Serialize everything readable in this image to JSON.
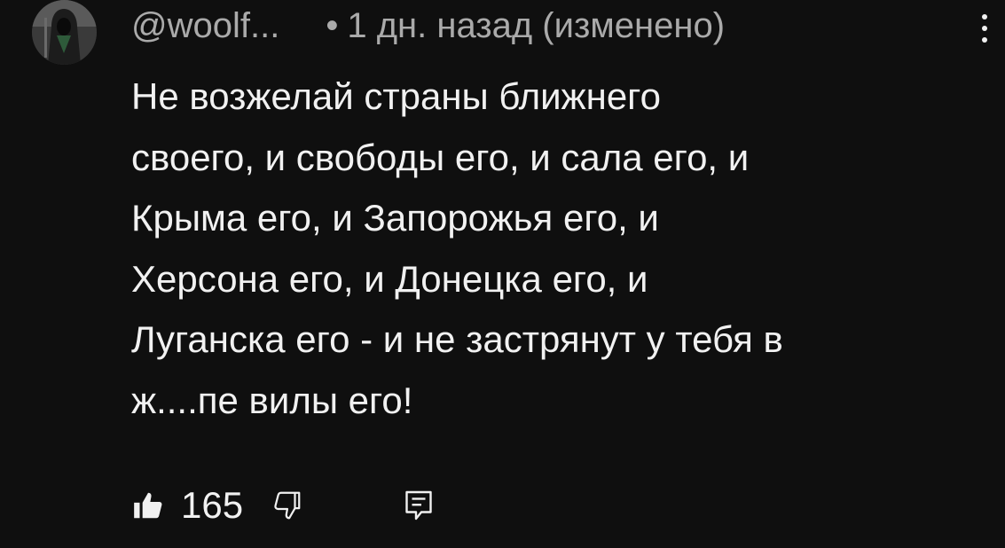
{
  "comment": {
    "author": "@woolf...",
    "separator": "•",
    "timestamp": "1 дн. назад (изменено)",
    "text_lines": [
      "Не возжелай страны ближнего",
      "своего, и свободы его, и сала его, и",
      "Крыма его, и Запорожья его, и",
      "Херсона его, и Донецка его, и",
      "Луганска его - и не застрянут у тебя в",
      "ж....пе вилы его!"
    ],
    "like_count": "165",
    "avatar_icon": "hooded-figure-avatar",
    "menu_icon": "more-vertical-icon",
    "like_icon": "thumbs-up-filled-icon",
    "dislike_icon": "thumbs-down-outline-icon",
    "reply_icon": "reply-comment-icon"
  },
  "colors": {
    "background": "#0f0f0f",
    "primary_text": "#f1f1f1",
    "secondary_text": "#aaaaaa"
  }
}
